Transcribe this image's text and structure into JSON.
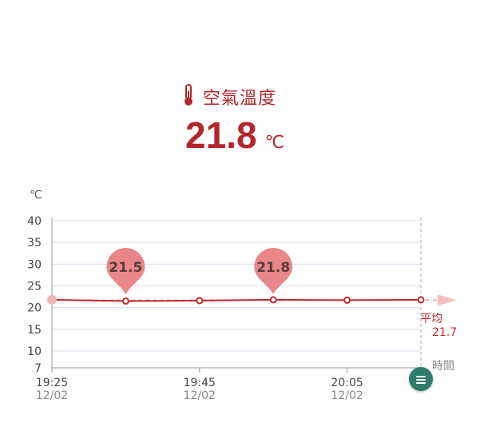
{
  "header": {
    "title": "空氣溫度",
    "value": "21.8",
    "unit": "℃",
    "icon": "thermometer-icon"
  },
  "chart_data": {
    "type": "line",
    "y_unit_label": "℃",
    "x_axis_label": "時間",
    "ylim": [
      7,
      40
    ],
    "y_ticks": [
      "40",
      "35",
      "30",
      "25",
      "20",
      "15",
      "10",
      "7"
    ],
    "x_ticks": [
      {
        "time": "19:25",
        "date": "12/02"
      },
      {
        "time": "19:45",
        "date": "12/02"
      },
      {
        "time": "20:05",
        "date": "12/02"
      }
    ],
    "x": [
      "19:25",
      "19:35",
      "19:45",
      "19:55",
      "20:05",
      "20:15"
    ],
    "series": [
      {
        "values": [
          21.8,
          21.5,
          21.6,
          21.8,
          21.7,
          21.8
        ]
      }
    ],
    "callouts": [
      {
        "x": "19:35",
        "label": "21.5"
      },
      {
        "x": "19:55",
        "label": "21.8"
      }
    ],
    "average": {
      "label": "平均",
      "value": "21.7",
      "y": 21.7
    },
    "grid": true,
    "colors": {
      "line": "#c0282d",
      "callout": "#e8868a",
      "average": "#f0a0a0",
      "grid": "#dcdcf0"
    }
  },
  "menu_button": {
    "icon": "menu-icon"
  }
}
